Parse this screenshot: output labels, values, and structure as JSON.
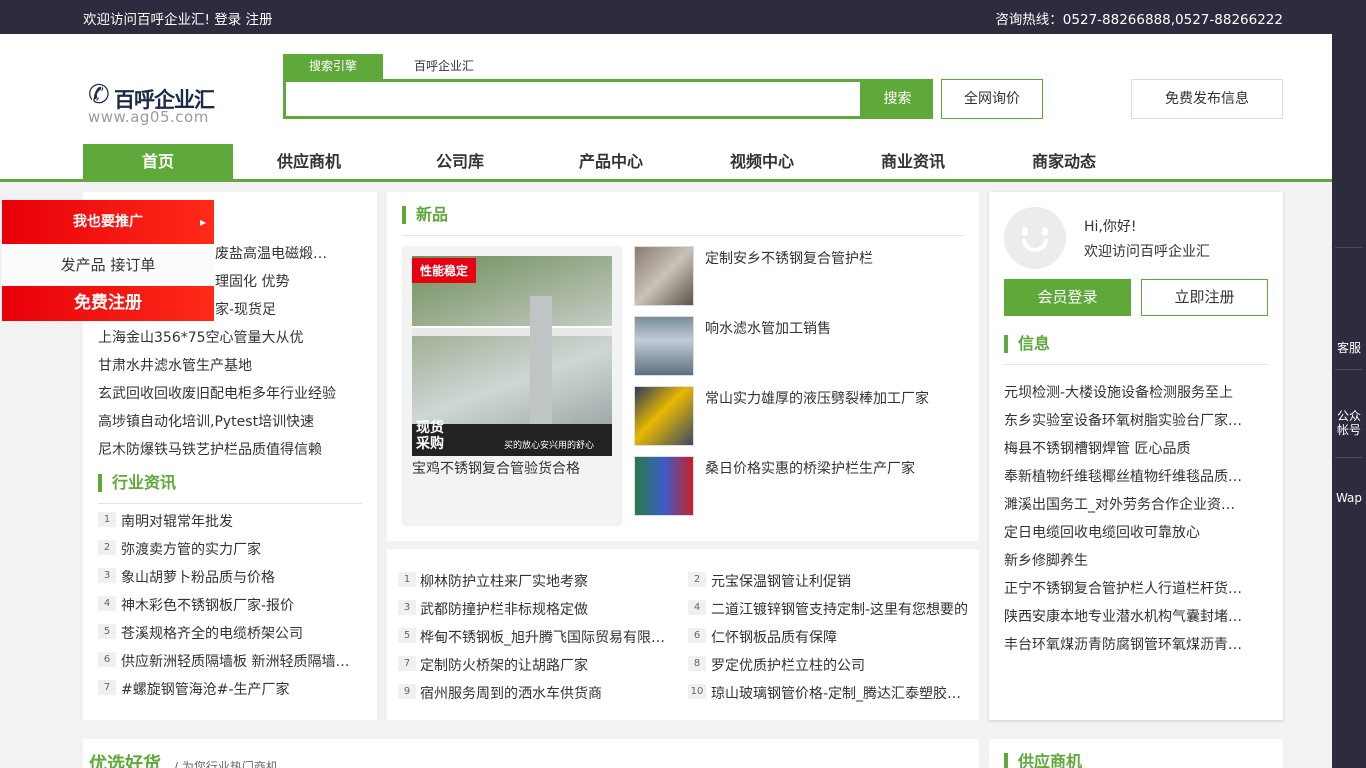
{
  "topbar": {
    "welcome": "欢迎访问百呼企业汇! 登录 注册",
    "hotline": "咨询热线：0527-88266888,0527-88266222"
  },
  "logo": {
    "name": "百呼企业汇",
    "url": "www.ag05.com"
  },
  "search": {
    "tab_active": "搜索引擎",
    "tab_other": "百呼企业汇",
    "value": "",
    "button": "搜索",
    "inquiry": "全网询价",
    "publish": "免费发布信息"
  },
  "nav": [
    "首页",
    "供应商机",
    "公司库",
    "产品中心",
    "视频中心",
    "商业资讯",
    "商家动态"
  ],
  "promo": {
    "promote": "我也要推广",
    "orders": "发产品 接订单",
    "register": "免费注册"
  },
  "left_lines": [
    "废盐高温电磁煅…",
    "理固化 优势",
    "家-现货足",
    "上海金山356*75空心管量大从优",
    "甘肃水井滤水管生产基地",
    "玄武回收回收废旧配电柜多年行业经验",
    "高埗镇自动化培训,Pytest培训快速",
    "尼木防爆铁马铁艺护栏品质值得信赖"
  ],
  "industry": {
    "title": "行业资讯",
    "items": [
      "南明对辊常年批发",
      "弥渡卖方管的实力厂家",
      "象山胡萝卜粉品质与价格",
      "神木彩色不锈钢板厂家-报价",
      "苍溪规格齐全的电缆桥架公司",
      "供应新洲轻质隔墙板 新洲轻质隔墙…",
      "#螺旋钢管海沧#-生产厂家"
    ]
  },
  "new_products": {
    "title": "新品",
    "big": {
      "tag": "性能稳定",
      "badge": "现货\n采购",
      "slogan": "买的放心安兴用的舒心",
      "caption": "宝鸡不锈钢复合管验货合格"
    },
    "items": [
      "定制安乡不锈钢复合管护栏",
      "响水滤水管加工销售",
      "常山实力雄厚的液压劈裂棒加工厂家",
      "桑日价格实惠的桥梁护栏生产厂家"
    ]
  },
  "numbered": [
    "柳林防护立柱来厂实地考察",
    "元宝保温钢管让利促销",
    "武都防撞护栏非标规格定做",
    "二道江镀锌钢管支持定制-这里有您想要的",
    "桦甸不锈钢板_旭升腾飞国际贸易有限…",
    "仁怀钢板品质有保障",
    "定制防火桥架的让胡路厂家",
    "罗定优质护栏立柱的公司",
    "宿州服务周到的洒水车供货商",
    "琼山玻璃钢管价格-定制_腾达汇泰塑胶…"
  ],
  "login": {
    "hi": "Hi,你好!",
    "welcome": "欢迎访问百呼企业汇",
    "member_login": "会员登录",
    "register": "立即注册"
  },
  "info": {
    "title": "信息",
    "items": [
      "元坝检测-大楼设施设备检测服务至上",
      "东乡实验室设备环氧树脂实验台厂家…",
      "梅县不锈钢槽钢焊管 匠心品质",
      "奉新植物纤维毯椰丝植物纤维毯品质…",
      "濉溪出国务工_对外劳务合作企业资…",
      "定日电缆回收电缆回收可靠放心",
      "新乡修脚养生",
      "正宁不锈钢复合管护栏人行道栏杆货…",
      "陕西安康本地专业潜水机构气囊封堵…",
      "丰台环氧煤沥青防腐钢管环氧煤沥青…"
    ]
  },
  "bottom": {
    "featured": "优选好货",
    "featured_sub": "/ 为您行业热门商机",
    "supply": "供应商机"
  },
  "rightbar": [
    "客服",
    "公众\n帐号",
    "Wap"
  ],
  "colors": {
    "brand_green": "#5fa83a",
    "topbar": "#2c2c3e",
    "promo_red": "#e8000a"
  }
}
